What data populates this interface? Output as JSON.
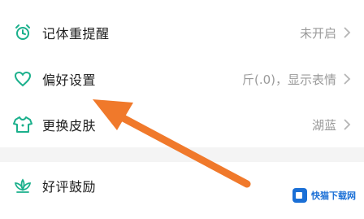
{
  "settings": {
    "items": [
      {
        "label": "记体重提醒",
        "value": "未开启",
        "icon": "alarm-clock-icon"
      },
      {
        "label": "偏好设置",
        "value": "斤(.0)，显示表情",
        "icon": "heart-outline-icon"
      },
      {
        "label": "更换皮肤",
        "value": "湖蓝",
        "icon": "tshirt-icon"
      },
      {
        "label": "好评鼓励",
        "value": "",
        "icon": "lotus-icon"
      }
    ]
  },
  "colors": {
    "accent": "#1bb08c",
    "arrow": "#f0792b",
    "muted_text": "#9a9a9a",
    "separator": "#f4f4f4"
  },
  "watermark": {
    "text": "快猫下载网"
  }
}
